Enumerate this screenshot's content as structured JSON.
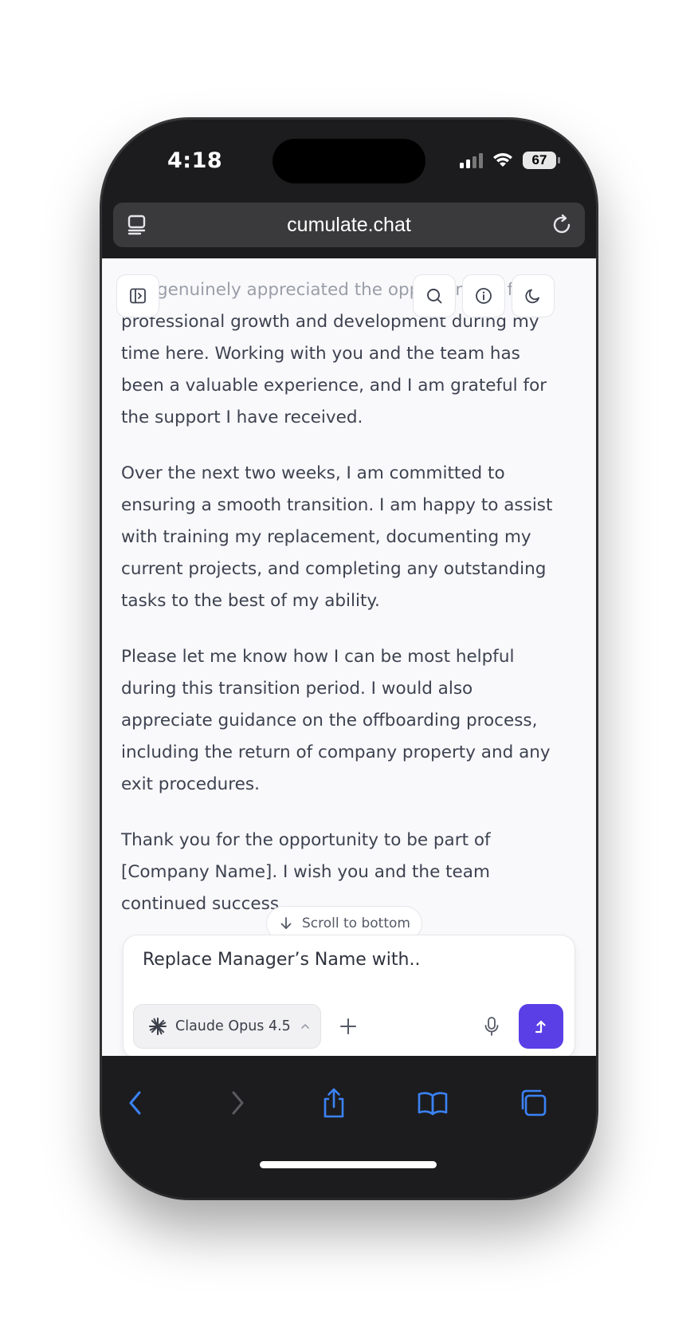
{
  "status_bar": {
    "time": "4:18",
    "battery": "67"
  },
  "browser": {
    "url": "cumulate.chat"
  },
  "message": {
    "fade_line": "I've genuinely appreciated the opportunities for",
    "paragraphs": [
      "professional growth and development during my time here. Working with you and the team has been a valuable experience, and I am grateful for the support I have received.",
      "Over the next two weeks, I am committed to ensuring a smooth transition. I am happy to assist with training my replacement, documenting my current projects, and completing any outstanding tasks to the best of my ability.",
      "Please let me know how I can be most helpful during this transition period. I would also appreciate guidance on the offboarding process, including the return of company property and any exit procedures.",
      "Thank you for the opportunity to be part of [Company Name]. I wish you and the team continued success."
    ]
  },
  "scroll_button": {
    "label": "Scroll to bottom"
  },
  "composer": {
    "input_value": "Replace Manager’s Name with..",
    "model_label": "Claude Opus 4.5"
  },
  "colors": {
    "accent": "#5a3fe6",
    "ios_blue": "#3b82f6",
    "text": "#3d4250"
  },
  "icons": [
    "sidebar-toggle-icon",
    "search-icon",
    "info-icon",
    "moon-icon",
    "arrow-down-icon",
    "claude-spark-icon",
    "chevron-up-icon",
    "plus-icon",
    "microphone-icon",
    "send-arrow-icon",
    "back-icon",
    "forward-icon",
    "share-icon",
    "bookmarks-icon",
    "tabs-icon",
    "reload-icon"
  ]
}
